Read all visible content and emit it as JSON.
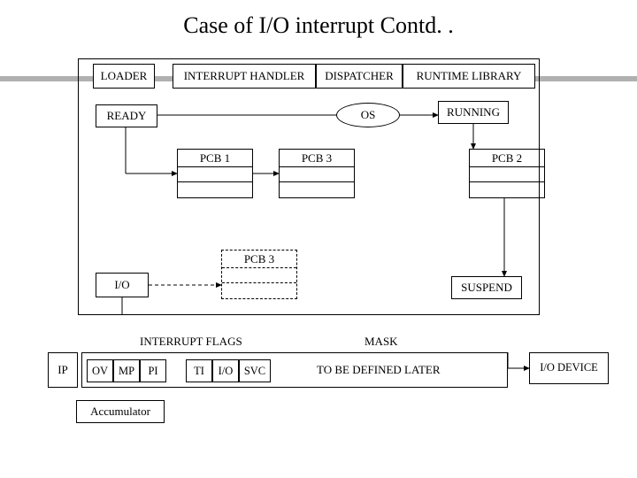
{
  "title": "Case of I/O interrupt Contd. .",
  "top": {
    "loader": "LOADER",
    "ih": "INTERRUPT HANDLER",
    "dispatcher": "DISPATCHER",
    "rtl": "RUNTIME LIBRARY"
  },
  "ready": "READY",
  "os": "OS",
  "running": "RUNNING",
  "pcb1": "PCB 1",
  "pcb3a": "PCB 3",
  "pcb2": "PCB 2",
  "pcb3b": "PCB 3",
  "io": "I/O",
  "suspend": "SUSPEND",
  "iflags": "INTERRUPT FLAGS",
  "mask": "MASK",
  "ip": "IP",
  "flags": {
    "ov": "OV",
    "mp": "MP",
    "pi": "PI",
    "ti": "TI",
    "io": "I/O",
    "svc": "SVC"
  },
  "tbdl": "TO BE DEFINED LATER",
  "iodev": "I/O DEVICE",
  "acc": "Accumulator"
}
